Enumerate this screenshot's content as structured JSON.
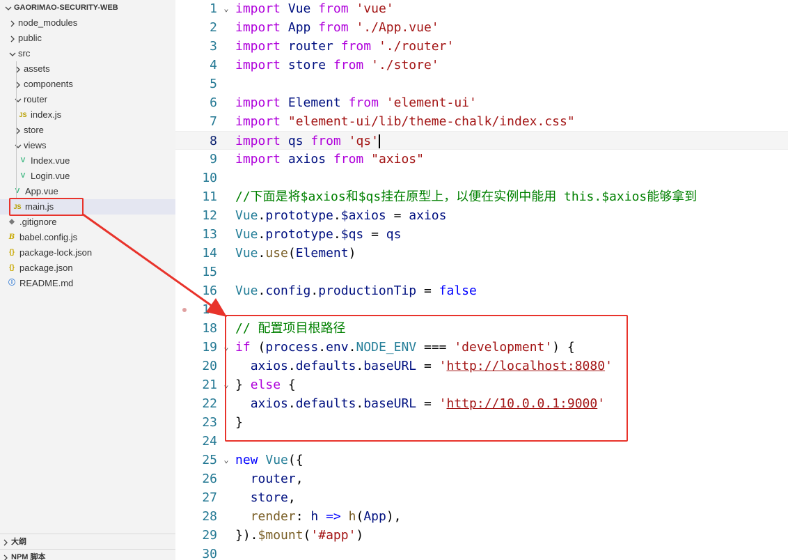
{
  "explorer": {
    "project_title": "GAORIMAO-SECURITY-WEB",
    "tree": [
      {
        "label": "node_modules",
        "icon": "chevron-right-icon",
        "depth": 1
      },
      {
        "label": "public",
        "icon": "chevron-right-icon",
        "depth": 1
      },
      {
        "label": "src",
        "icon": "chevron-down-icon",
        "depth": 1
      },
      {
        "label": "assets",
        "icon": "chevron-right-icon",
        "depth": 2
      },
      {
        "label": "components",
        "icon": "chevron-right-icon",
        "depth": 2
      },
      {
        "label": "router",
        "icon": "chevron-down-icon",
        "depth": 2
      },
      {
        "label": "index.js",
        "icon": "js-file-icon",
        "icon_text": "JS",
        "depth": 3
      },
      {
        "label": "store",
        "icon": "chevron-right-icon",
        "depth": 2
      },
      {
        "label": "views",
        "icon": "chevron-down-icon",
        "depth": 2
      },
      {
        "label": "Index.vue",
        "icon": "vue-file-icon",
        "icon_text": "V",
        "depth": 3
      },
      {
        "label": "Login.vue",
        "icon": "vue-file-icon",
        "icon_text": "V",
        "depth": 3
      },
      {
        "label": "App.vue",
        "icon": "vue-file-icon",
        "icon_text": "V",
        "depth": 2
      },
      {
        "label": "main.js",
        "icon": "js-file-icon",
        "icon_text": "JS",
        "depth": 2,
        "selected": true
      },
      {
        "label": ".gitignore",
        "icon": "git-file-icon",
        "icon_text": "◆",
        "depth": 1
      },
      {
        "label": "babel.config.js",
        "icon": "babel-file-icon",
        "icon_text": "B",
        "depth": 1
      },
      {
        "label": "package-lock.json",
        "icon": "json-file-icon",
        "icon_text": "{}",
        "depth": 1
      },
      {
        "label": "package.json",
        "icon": "json-file-icon",
        "icon_text": "{}",
        "depth": 1
      },
      {
        "label": "README.md",
        "icon": "info-file-icon",
        "icon_text": "ⓘ",
        "depth": 1
      }
    ],
    "outline_label": "大纲",
    "npm_scripts_label": "NPM 脚本"
  },
  "editor": {
    "active_line": 8,
    "lines": [
      {
        "n": "1",
        "fold": "⌄",
        "tokens": [
          [
            "kc",
            "import"
          ],
          [
            "",
            " "
          ],
          [
            "vr",
            "Vue"
          ],
          [
            "",
            " "
          ],
          [
            "kc",
            "from"
          ],
          [
            "",
            " "
          ],
          [
            "str",
            "'vue'"
          ]
        ]
      },
      {
        "n": "2",
        "fold": "",
        "tokens": [
          [
            "kc",
            "import"
          ],
          [
            "",
            " "
          ],
          [
            "vr",
            "App"
          ],
          [
            "",
            " "
          ],
          [
            "kc",
            "from"
          ],
          [
            "",
            " "
          ],
          [
            "str",
            "'./App.vue'"
          ]
        ]
      },
      {
        "n": "3",
        "fold": "",
        "tokens": [
          [
            "kc",
            "import"
          ],
          [
            "",
            " "
          ],
          [
            "vr",
            "router"
          ],
          [
            "",
            " "
          ],
          [
            "kc",
            "from"
          ],
          [
            "",
            " "
          ],
          [
            "str",
            "'./router'"
          ]
        ]
      },
      {
        "n": "4",
        "fold": "",
        "tokens": [
          [
            "kc",
            "import"
          ],
          [
            "",
            " "
          ],
          [
            "vr",
            "store"
          ],
          [
            "",
            " "
          ],
          [
            "kc",
            "from"
          ],
          [
            "",
            " "
          ],
          [
            "str",
            "'./store'"
          ]
        ]
      },
      {
        "n": "5",
        "fold": "",
        "tokens": []
      },
      {
        "n": "6",
        "fold": "",
        "tokens": [
          [
            "kc",
            "import"
          ],
          [
            "",
            " "
          ],
          [
            "vr",
            "Element"
          ],
          [
            "",
            " "
          ],
          [
            "kc",
            "from"
          ],
          [
            "",
            " "
          ],
          [
            "str",
            "'element-ui'"
          ]
        ]
      },
      {
        "n": "7",
        "fold": "",
        "tokens": [
          [
            "kc",
            "import"
          ],
          [
            "",
            " "
          ],
          [
            "str",
            "\"element-ui/lib/theme-chalk/index.css\""
          ]
        ]
      },
      {
        "n": "8",
        "fold": "",
        "tokens": [
          [
            "kc",
            "import"
          ],
          [
            "",
            " "
          ],
          [
            "vr",
            "qs"
          ],
          [
            "",
            " "
          ],
          [
            "kc",
            "from"
          ],
          [
            "",
            " "
          ],
          [
            "str",
            "'qs'"
          ],
          [
            "cursor",
            ""
          ]
        ]
      },
      {
        "n": "9",
        "fold": "",
        "tokens": [
          [
            "kc",
            "import"
          ],
          [
            "",
            " "
          ],
          [
            "vr",
            "axios"
          ],
          [
            "",
            " "
          ],
          [
            "kc",
            "from"
          ],
          [
            "",
            " "
          ],
          [
            "str",
            "\"axios\""
          ]
        ]
      },
      {
        "n": "10",
        "fold": "",
        "tokens": []
      },
      {
        "n": "11",
        "fold": "",
        "tokens": [
          [
            "cm",
            "//下面是将$axios和$qs挂在原型上，以便在实例中能用 this.$axios能够拿到"
          ]
        ]
      },
      {
        "n": "12",
        "fold": "",
        "tokens": [
          [
            "ty",
            "Vue"
          ],
          [
            "",
            "."
          ],
          [
            "vr",
            "prototype"
          ],
          [
            "",
            "."
          ],
          [
            "vr",
            "$axios"
          ],
          [
            "",
            " = "
          ],
          [
            "vr",
            "axios"
          ]
        ]
      },
      {
        "n": "13",
        "fold": "",
        "tokens": [
          [
            "ty",
            "Vue"
          ],
          [
            "",
            "."
          ],
          [
            "vr",
            "prototype"
          ],
          [
            "",
            "."
          ],
          [
            "vr",
            "$qs"
          ],
          [
            "",
            " = "
          ],
          [
            "vr",
            "qs"
          ]
        ]
      },
      {
        "n": "14",
        "fold": "",
        "tokens": [
          [
            "ty",
            "Vue"
          ],
          [
            "",
            "."
          ],
          [
            "fn",
            "use"
          ],
          [
            "",
            "("
          ],
          [
            "vr",
            "Element"
          ],
          [
            "",
            ")"
          ]
        ]
      },
      {
        "n": "15",
        "fold": "",
        "tokens": []
      },
      {
        "n": "16",
        "fold": "",
        "tokens": [
          [
            "ty",
            "Vue"
          ],
          [
            "",
            "."
          ],
          [
            "vr",
            "config"
          ],
          [
            "",
            "."
          ],
          [
            "vr",
            "productionTip"
          ],
          [
            "",
            " = "
          ],
          [
            "kw",
            "false"
          ]
        ]
      },
      {
        "n": "17",
        "fold": "",
        "tokens": []
      },
      {
        "n": "18",
        "fold": "",
        "tokens": [
          [
            "cm",
            "// 配置项目根路径"
          ]
        ]
      },
      {
        "n": "19",
        "fold": "⌄",
        "tokens": [
          [
            "kc",
            "if"
          ],
          [
            "",
            " ("
          ],
          [
            "vr",
            "process"
          ],
          [
            "",
            "."
          ],
          [
            "vr",
            "env"
          ],
          [
            "",
            "."
          ],
          [
            "ty",
            "NODE_ENV"
          ],
          [
            "",
            " === "
          ],
          [
            "str",
            "'development'"
          ],
          [
            "",
            ") {"
          ]
        ]
      },
      {
        "n": "20",
        "fold": "",
        "tokens": [
          [
            "",
            "  "
          ],
          [
            "vr",
            "axios"
          ],
          [
            "",
            "."
          ],
          [
            "vr",
            "defaults"
          ],
          [
            "",
            "."
          ],
          [
            "vr",
            "baseURL"
          ],
          [
            "",
            " = "
          ],
          [
            "str",
            "'"
          ],
          [
            "strurl",
            "http://localhost:8080"
          ],
          [
            "str",
            "'"
          ]
        ]
      },
      {
        "n": "21",
        "fold": "⌄",
        "tokens": [
          [
            "",
            "} "
          ],
          [
            "kc",
            "else"
          ],
          [
            "",
            " {"
          ]
        ]
      },
      {
        "n": "22",
        "fold": "",
        "tokens": [
          [
            "",
            "  "
          ],
          [
            "vr",
            "axios"
          ],
          [
            "",
            "."
          ],
          [
            "vr",
            "defaults"
          ],
          [
            "",
            "."
          ],
          [
            "vr",
            "baseURL"
          ],
          [
            "",
            " = "
          ],
          [
            "str",
            "'"
          ],
          [
            "strurl",
            "http://10.0.0.1:9000"
          ],
          [
            "str",
            "'"
          ]
        ]
      },
      {
        "n": "23",
        "fold": "",
        "tokens": [
          [
            "",
            "}"
          ]
        ]
      },
      {
        "n": "24",
        "fold": "",
        "tokens": []
      },
      {
        "n": "25",
        "fold": "⌄",
        "tokens": [
          [
            "kw",
            "new"
          ],
          [
            "",
            " "
          ],
          [
            "ty",
            "Vue"
          ],
          [
            "",
            "({"
          ]
        ]
      },
      {
        "n": "26",
        "fold": "",
        "tokens": [
          [
            "",
            "  "
          ],
          [
            "vr",
            "router"
          ],
          [
            "",
            ","
          ]
        ]
      },
      {
        "n": "27",
        "fold": "",
        "tokens": [
          [
            "",
            "  "
          ],
          [
            "vr",
            "store"
          ],
          [
            "",
            ","
          ]
        ]
      },
      {
        "n": "28",
        "fold": "",
        "tokens": [
          [
            "",
            "  "
          ],
          [
            "fn",
            "render"
          ],
          [
            "",
            ": "
          ],
          [
            "vr",
            "h"
          ],
          [
            "",
            " "
          ],
          [
            "kw",
            "=>"
          ],
          [
            "",
            " "
          ],
          [
            "fn",
            "h"
          ],
          [
            "",
            "("
          ],
          [
            "vr",
            "App"
          ],
          [
            "",
            "),"
          ]
        ]
      },
      {
        "n": "29",
        "fold": "",
        "tokens": [
          [
            "",
            "})."
          ],
          [
            "fn",
            "$mount"
          ],
          [
            "",
            "("
          ],
          [
            "str",
            "'#app'"
          ],
          [
            "",
            ")"
          ]
        ]
      },
      {
        "n": "30",
        "fold": "",
        "tokens": []
      }
    ]
  },
  "colors": {
    "annotation_red": "#e8332b",
    "sidebar_bg": "#f3f3f3",
    "selected_bg": "#e4e6f1"
  }
}
